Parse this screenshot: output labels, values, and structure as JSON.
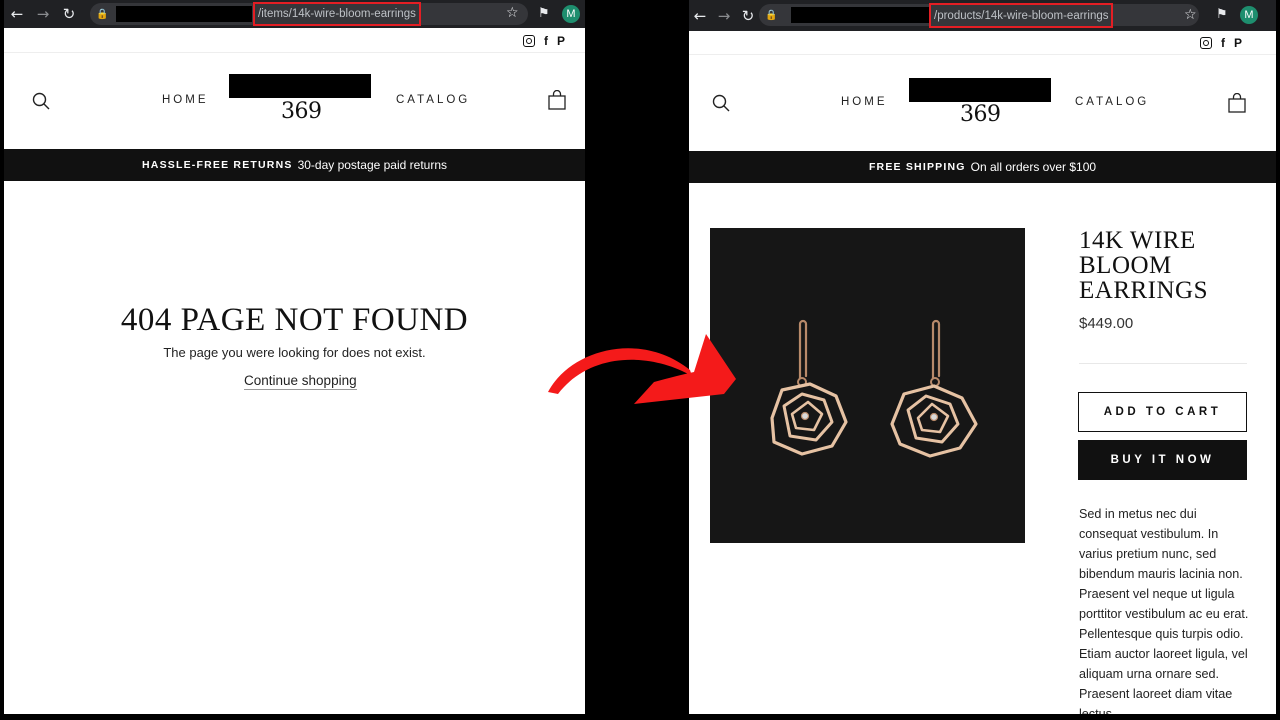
{
  "left": {
    "browser": {
      "url_path": "/items/14k-wire-bloom-earrings",
      "profile_initial": "M"
    },
    "social": [
      "instagram-icon",
      "facebook-icon",
      "pinterest-icon"
    ],
    "nav": {
      "home": "HOME",
      "catalog": "CATALOG",
      "logo_number": "369"
    },
    "banner": {
      "bold": "HASSLE-FREE RETURNS",
      "text": "30-day postage paid returns"
    },
    "not_found": {
      "title": "404 PAGE NOT FOUND",
      "message": "The page you were looking for does not exist.",
      "link": "Continue shopping"
    }
  },
  "right": {
    "browser": {
      "url_path": "/products/14k-wire-bloom-earrings",
      "profile_initial": "M"
    },
    "social": [
      "instagram-icon",
      "facebook-icon",
      "pinterest-icon"
    ],
    "nav": {
      "home": "HOME",
      "catalog": "CATALOG",
      "logo_number": "369"
    },
    "banner": {
      "bold": "FREE SHIPPING",
      "text": "On all orders over $100"
    },
    "product": {
      "title": "14K WIRE BLOOM EARRINGS",
      "price": "$449.00",
      "add_to_cart": "ADD TO CART",
      "buy_now": "BUY IT NOW",
      "description": "Sed in metus nec dui consequat vestibulum. In varius pretium nunc, sed bibendum mauris lacinia non. Praesent vel neque ut ligula porttitor vestibulum ac eu erat. Pellentesque quis turpis odio. Etiam auctor laoreet ligula, vel aliquam urna ornare sed. Praesent laoreet diam vitae lectus"
    }
  },
  "colors": {
    "highlight": "#e31e24",
    "arrow": "#f41a1a",
    "banner": "#111111",
    "avatar": "#1e8e6e"
  }
}
